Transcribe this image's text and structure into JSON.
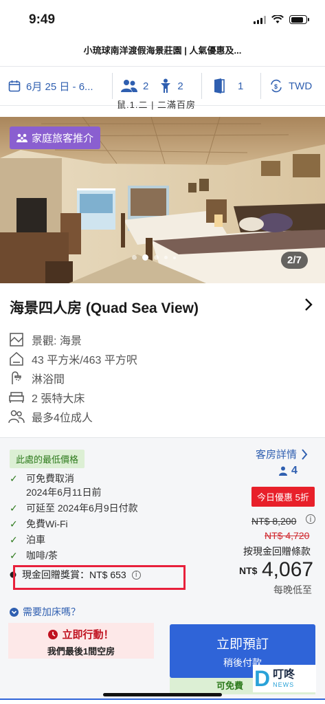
{
  "status": {
    "time": "9:49"
  },
  "header": {
    "title": "小琉球南洋渡假海景莊園 | 人氣優惠及..."
  },
  "filters": {
    "dates": "6月 25 日 - 6...",
    "adults": "2",
    "children": "2",
    "rooms": "1",
    "currency": "TWD"
  },
  "peek_text": "鼠.1.二 | 二滿百房",
  "gallery": {
    "badge": "家庭旅客推介",
    "counter": "2/7"
  },
  "room": {
    "title": "海景四人房 (Quad Sea View)",
    "features": [
      {
        "icon": "view-icon",
        "label": "景觀: 海景"
      },
      {
        "icon": "room-size-icon",
        "label": "43 平方米/463 平方呎"
      },
      {
        "icon": "shower-icon",
        "label": "淋浴間"
      },
      {
        "icon": "bed-icon",
        "label": "2 張特大床"
      },
      {
        "icon": "guests-icon",
        "label": "最多4位成人"
      }
    ]
  },
  "rate": {
    "lowest_tag": "此處的最低價格",
    "benefits": [
      {
        "line1": "可免費取消",
        "line2": "2024年6月11日前"
      },
      {
        "line1": "可延至 2024年6月9日付款",
        "line2": ""
      },
      {
        "line1": "免費Wi-Fi",
        "line2": ""
      },
      {
        "line1": "泊車",
        "line2": ""
      },
      {
        "line1": "咖啡/茶",
        "line2": ""
      }
    ],
    "cashback": "現金回贈獎賞：NT$ 653",
    "details_link": "客房詳情",
    "occupancy": "4",
    "deal_badge": "今日優惠 5折",
    "original_price": "NT$ 8,200",
    "discounted_price": "NT$ 4,720",
    "cash_note": "按現金回贈條款",
    "currency": "NT$",
    "price": "4,067",
    "per_night": "每晚低至",
    "extra_bed": "需要加床嗎？"
  },
  "urgency": {
    "title": "立即行動！",
    "subtitle": "我們最後1間空房"
  },
  "booking": {
    "title": "立即預訂",
    "subtitle": "稍後付款",
    "free_strip": "可免費"
  },
  "watermark": {
    "logo_letter": "D",
    "logo_zh": "叮咚",
    "logo_en": "NEWS"
  },
  "colors": {
    "accent": "#2f5fb0",
    "book_button": "#2f64d8",
    "deal_red": "#e8202a",
    "badge_purple": "#8a5fd0",
    "benefit_green": "#2d7a1c"
  }
}
